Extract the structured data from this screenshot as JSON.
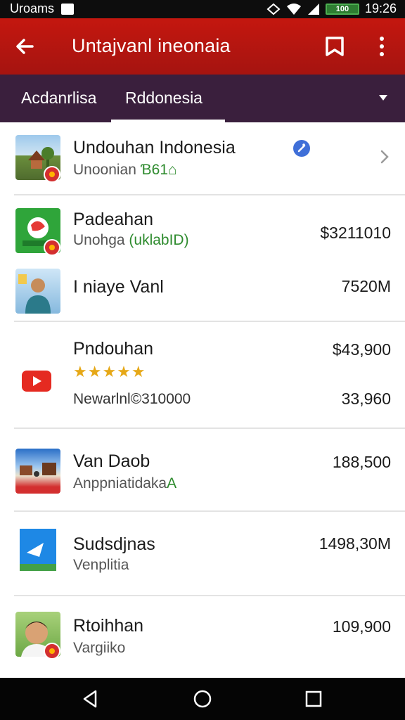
{
  "status_bar": {
    "carrier": "Uroams",
    "battery_label": "100",
    "time": "19:26"
  },
  "app_bar": {
    "title": "Untajvanl ineonaia"
  },
  "tabs": [
    {
      "label": "Acdanrlisa"
    },
    {
      "label": "Rddonesia"
    }
  ],
  "list": [
    {
      "title": "Undouhan Indonesia",
      "subtitle": "Unoonian",
      "subtitle_extra": "Ɓ61⌂",
      "value": ""
    },
    {
      "title": "Padeahan",
      "subtitle": "Unohga",
      "subtitle_extra": "(uklabID)",
      "value": "$3211010"
    },
    {
      "title": "I niaye Vanl",
      "subtitle": "",
      "subtitle_extra": "",
      "value": "7520M"
    },
    {
      "title": "Pndouhan",
      "rating_text": "★★★★★",
      "subtitle": "Newarlnl©310000",
      "value": "$43,900",
      "value2": "33,960"
    },
    {
      "title": "Van Daob",
      "subtitle": "Anppniatidaka",
      "subtitle_extra": "A",
      "value": "188,500"
    },
    {
      "title": "Sudsdjnas",
      "subtitle": "Venplitia",
      "subtitle_extra": "",
      "value": "1498,30M"
    },
    {
      "title": "Rtoihhan",
      "subtitle": "Vargiiko",
      "subtitle_extra": "",
      "value": "109,900"
    }
  ],
  "colors": {
    "app_bar": "#c4170f",
    "tab_bar": "#3a1f3d",
    "badge": "#d32f2f",
    "info": "#3f6fd8"
  }
}
